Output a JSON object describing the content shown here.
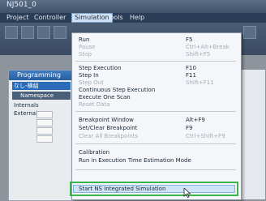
{
  "window": {
    "title": "NJ501_0"
  },
  "menubar": {
    "items": [
      {
        "label": "Project"
      },
      {
        "label": "Controller"
      },
      {
        "label": "Simulation"
      },
      {
        "label": "Tools"
      },
      {
        "label": "Help"
      }
    ]
  },
  "left_panel": {
    "header": "Programming",
    "subheader": "なし-横組",
    "namespace": "Namespace",
    "rows": [
      "Internals",
      "Externals"
    ]
  },
  "dropdown": {
    "items": [
      {
        "label": "Run",
        "shortcut": "F5",
        "enabled": true
      },
      {
        "label": "Pause",
        "shortcut": "Ctrl+Alt+Break",
        "enabled": false
      },
      {
        "label": "Stop",
        "shortcut": "Shift+F5",
        "enabled": false
      },
      {
        "label": "Step Execution",
        "shortcut": "F10",
        "enabled": true
      },
      {
        "label": "Step In",
        "shortcut": "F11",
        "enabled": true
      },
      {
        "label": "Step Out",
        "shortcut": "Shift+F11",
        "enabled": false
      },
      {
        "label": "Continuous Step Execution",
        "shortcut": "",
        "enabled": true
      },
      {
        "label": "Execute One Scan",
        "shortcut": "",
        "enabled": true
      },
      {
        "label": "Reset Data",
        "shortcut": "",
        "enabled": false
      },
      {
        "label": "Breakpoint Window",
        "shortcut": "Alt+F9",
        "enabled": true
      },
      {
        "label": "Set/Clear Breakpoint",
        "shortcut": "F9",
        "enabled": true
      },
      {
        "label": "Clear All Breakpoints",
        "shortcut": "Ctrl+Shift+F9",
        "enabled": false
      },
      {
        "label": "Calibration",
        "shortcut": "",
        "enabled": true
      },
      {
        "label": "Run in Execution Time Estimation Mode",
        "shortcut": "",
        "enabled": true
      }
    ],
    "highlighted_item": "Start NS Integrated Simulation"
  },
  "colors": {
    "highlight_border": "#3bb54a",
    "menu_bg": "#f4f6f9"
  }
}
